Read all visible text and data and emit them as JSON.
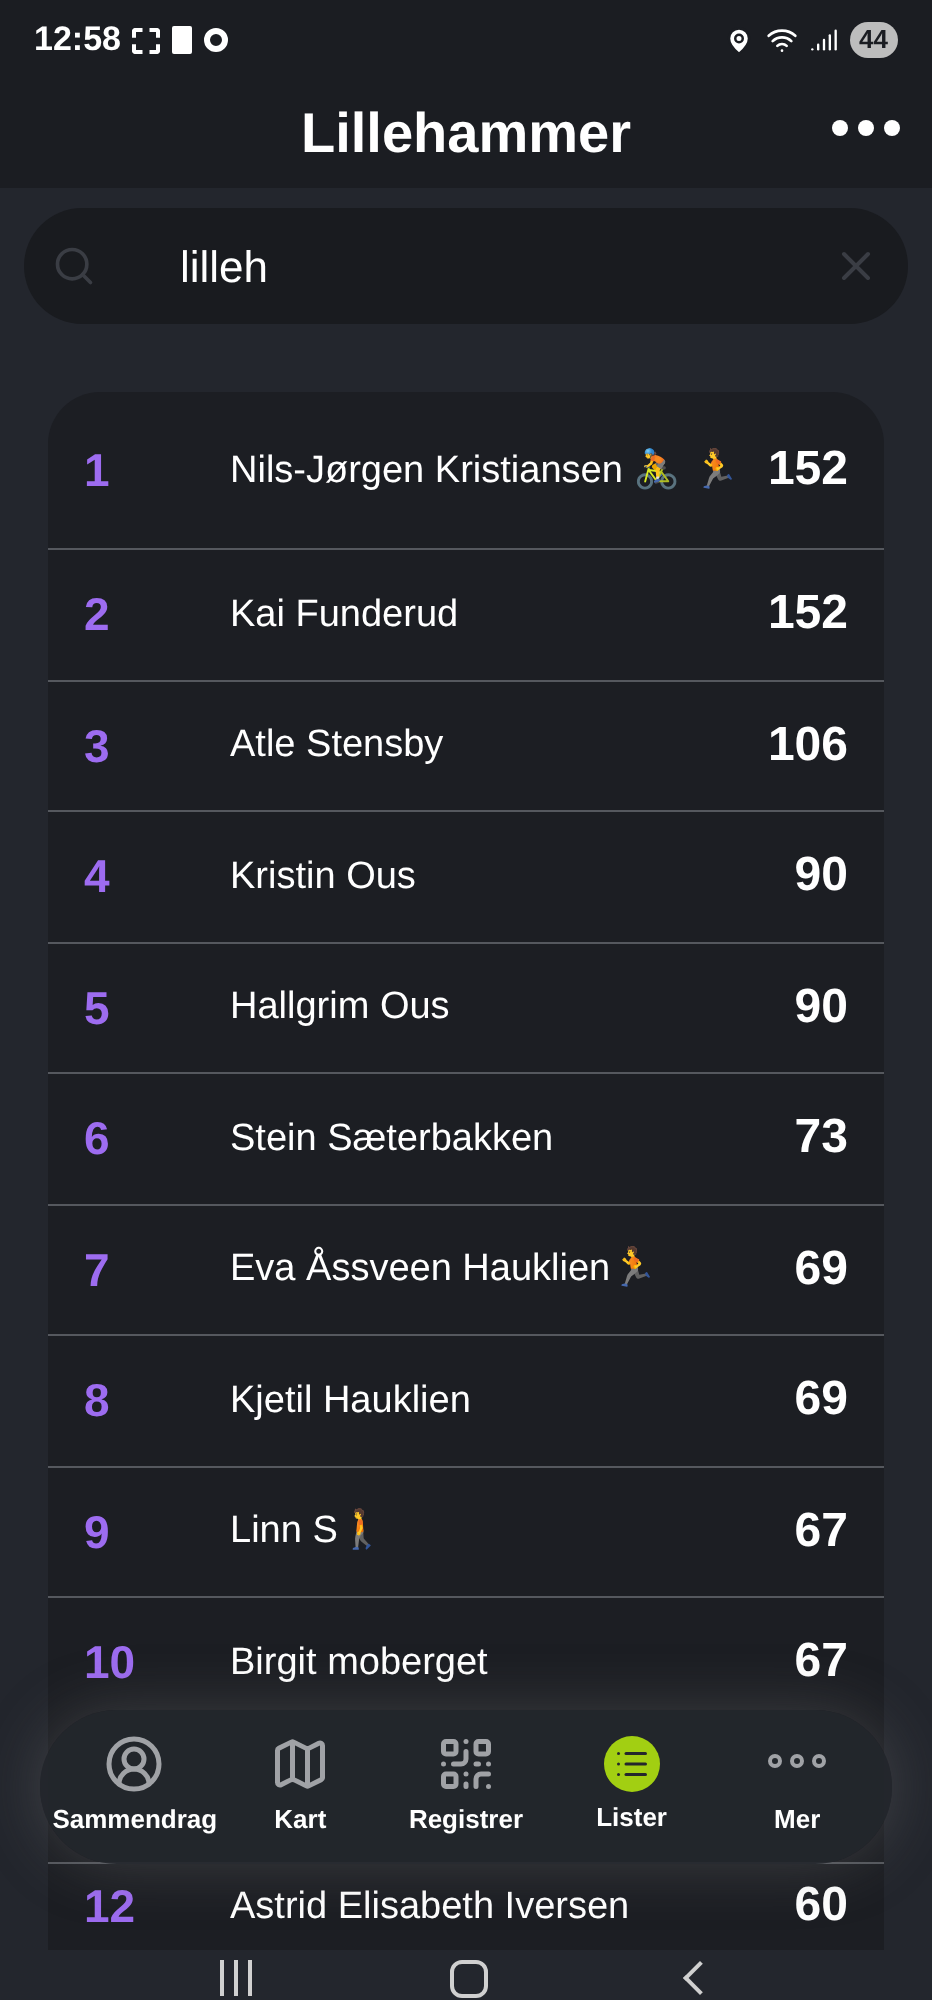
{
  "status_bar": {
    "time": "12:58",
    "battery": "44"
  },
  "header": {
    "title": "Lillehammer"
  },
  "search": {
    "value": "lilleh"
  },
  "rows": [
    {
      "rank": "1",
      "name": "Nils-Jørgen Kristiansen 🚴 🏃",
      "score": "152"
    },
    {
      "rank": "2",
      "name": "Kai Funderud",
      "score": "152"
    },
    {
      "rank": "3",
      "name": "Atle Stensby",
      "score": "106"
    },
    {
      "rank": "4",
      "name": "Kristin  Ous",
      "score": "90"
    },
    {
      "rank": "5",
      "name": "Hallgrim Ous",
      "score": "90"
    },
    {
      "rank": "6",
      "name": "Stein Sæterbakken",
      "score": "73"
    },
    {
      "rank": "7",
      "name": "Eva Åssveen Hauklien🏃",
      "score": "69"
    },
    {
      "rank": "8",
      "name": "Kjetil Hauklien",
      "score": "69"
    },
    {
      "rank": "9",
      "name": "Linn S🚶",
      "score": "67"
    },
    {
      "rank": "10",
      "name": "Birgit moberget",
      "score": "67"
    },
    {
      "rank": "12",
      "name": "Astrid Elisabeth Iversen",
      "score": "60"
    }
  ],
  "bottom_nav": [
    {
      "kind": "profile",
      "label": "Sammendrag",
      "selected": false
    },
    {
      "kind": "map",
      "label": "Kart",
      "selected": false
    },
    {
      "kind": "qr",
      "label": "Registrer",
      "selected": false
    },
    {
      "kind": "list",
      "label": "Lister",
      "selected": true
    },
    {
      "kind": "more",
      "label": "Mer",
      "selected": false
    }
  ]
}
